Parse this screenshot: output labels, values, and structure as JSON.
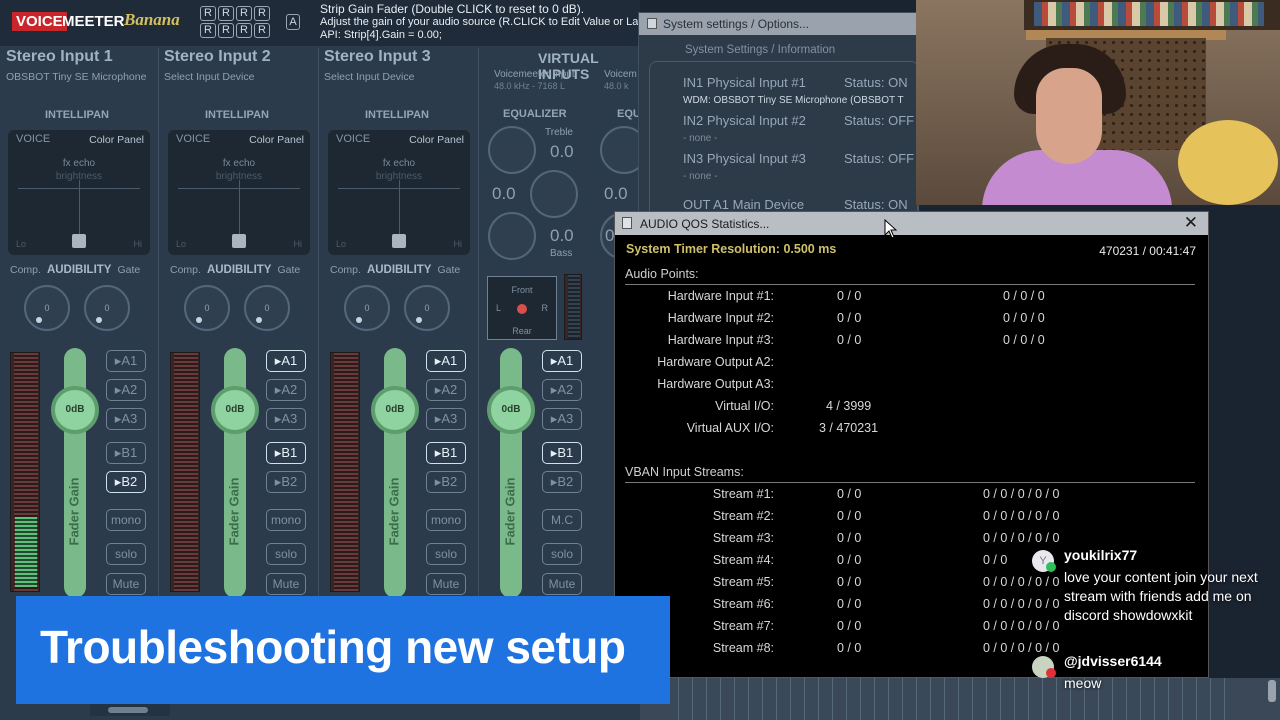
{
  "voicemeeter": {
    "logo_voice": "VOICE",
    "logo_meeter": "MEETER",
    "logo_banana": "Banana",
    "r_buttons": [
      "R",
      "R",
      "R",
      "R",
      "R",
      "R",
      "R",
      "R"
    ],
    "a_button": "A",
    "help_line1": "Strip Gain Fader (Double CLICK to reset to 0 dB).",
    "help_line2": "Adjust the gain of your audio source (R.CLICK to Edit Value or Lab",
    "help_line3": "API: Strip[4].Gain = 0.00;",
    "strips": [
      {
        "title": "Stereo Input 1",
        "device": "OBSBOT Tiny SE Microphone"
      },
      {
        "title": "Stereo Input 2",
        "device": "Select Input Device"
      },
      {
        "title": "Stereo Input 3",
        "device": "Select Input Device"
      }
    ],
    "virtual_inputs_title": "VIRTUAL INPUTS",
    "virtual_inputs": [
      {
        "name": "Voicemeeter Input",
        "info": "48.0 kHz - 7168 L"
      },
      {
        "name": "Voicem",
        "info": "48.0 k"
      }
    ],
    "intellipan": {
      "label": "INTELLIPAN",
      "voice": "VOICE",
      "color_panel": "Color Panel",
      "fx": "fx echo",
      "brightness": "brightness",
      "lo": "Lo",
      "hi": "Hi"
    },
    "audibility": {
      "comp": "Comp.",
      "label": "AUDIBILITY",
      "gate": "Gate"
    },
    "dial_value": "0",
    "fader_cap": "0dB",
    "fader_label": "Fader Gain",
    "buses": {
      "a1": "A1",
      "a2": "A2",
      "a3": "A3",
      "b1": "B1",
      "b2": "B2",
      "mono": "mono",
      "solo": "solo",
      "mute": "Mute",
      "mc": "M.C"
    },
    "equalizer": {
      "label": "EQUALIZER",
      "label2": "EQU",
      "treble": "Treble",
      "treble_value": "0.0",
      "mid_value": "0.0",
      "bass_value": "0.0",
      "bass": "Bass",
      "second_value": "0.0",
      "second_bass_value": "0.0"
    },
    "pan": {
      "front": "Front",
      "rear": "Rear",
      "l": "L",
      "r": "R"
    }
  },
  "banner": {
    "text": "Troubleshooting new setup"
  },
  "system_settings": {
    "title": "System settings / Options...",
    "header": "System Settings / Information",
    "rows": [
      {
        "label": "IN1 Physical Input #1",
        "status": "Status: ON",
        "detail": "WDM: OBSBOT Tiny SE Microphone (OBSBOT T"
      },
      {
        "label": "IN2 Physical Input #2",
        "status": "Status: OFF",
        "detail": "- none -"
      },
      {
        "label": "IN3 Physical Input #3",
        "status": "Status: OFF",
        "detail": "- none -"
      },
      {
        "label": "OUT A1 Main Device",
        "status": "Status: ON"
      }
    ]
  },
  "qos": {
    "title": "AUDIO QOS Statistics...",
    "close": "✕",
    "timer": "System Timer Resolution: 0.500 ms",
    "stamp": "470231 / 00:41:47",
    "audio_points_label": "Audio Points:",
    "audio_points": [
      {
        "label": "Hardware Input #1:",
        "v1": "0 / 0",
        "v2": "0 / 0 / 0"
      },
      {
        "label": "Hardware Input #2:",
        "v1": "0 / 0",
        "v2": "0 / 0 / 0"
      },
      {
        "label": "Hardware Input #3:",
        "v1": "0 / 0",
        "v2": "0 / 0 / 0"
      },
      {
        "label": "Hardware Output A2:",
        "v1": "",
        "v2": ""
      },
      {
        "label": "Hardware Output A3:",
        "v1": "",
        "v2": ""
      },
      {
        "label": "Virtual I/O:",
        "v1": "4 / 3999",
        "v2": ""
      },
      {
        "label": "Virtual AUX I/O:",
        "v1": "3 / 470231",
        "v2": ""
      }
    ],
    "vban_label": "VBAN Input Streams:",
    "streams": [
      {
        "label": "Stream #1:",
        "v1": "0 / 0",
        "v2": "0 / 0 / 0 / 0 / 0"
      },
      {
        "label": "Stream #2:",
        "v1": "0 / 0",
        "v2": "0 / 0 / 0 / 0 / 0"
      },
      {
        "label": "Stream #3:",
        "v1": "0 / 0",
        "v2": "0 / 0 / 0 / 0 / 0"
      },
      {
        "label": "Stream #4:",
        "v1": "0 / 0",
        "v2": "0 / 0"
      },
      {
        "label": "Stream #5:",
        "v1": "0 / 0",
        "v2": "0 / 0 / 0 / 0 / 0"
      },
      {
        "label": "Stream #6:",
        "v1": "0 / 0",
        "v2": "0 / 0 / 0 / 0 / 0"
      },
      {
        "label": "Stream #7:",
        "v1": "0 / 0",
        "v2": "0 / 0 / 0 / 0 / 0"
      },
      {
        "label": "Stream #8:",
        "v1": "0 / 0",
        "v2": "0 / 0 / 0 / 0 / 0"
      }
    ]
  },
  "chat": [
    {
      "avatar": "Y",
      "user": "youkilrix77",
      "message": "love your content join your next stream with friends add me on discord showdowxkit",
      "badge_color": "#2fbf5b"
    },
    {
      "avatar": "",
      "user": "@jdvisser6144",
      "message": "meow",
      "badge_color": "#e0303a"
    }
  ],
  "colors": {
    "banner": "#1f73e0",
    "timer_text": "#cfc06a",
    "logo_red": "#c9262c",
    "fader_green": "#7ab98a"
  }
}
